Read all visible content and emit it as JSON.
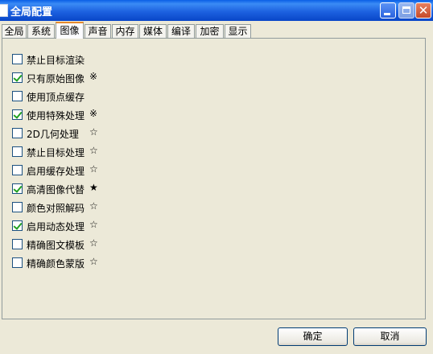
{
  "window": {
    "title": "全局配置"
  },
  "tabs": [
    {
      "label": "全局"
    },
    {
      "label": "系统"
    },
    {
      "label": "图像"
    },
    {
      "label": "声音"
    },
    {
      "label": "内存"
    },
    {
      "label": "媒体"
    },
    {
      "label": "编译"
    },
    {
      "label": "加密"
    },
    {
      "label": "显示"
    }
  ],
  "active_tab": "图像",
  "options": [
    {
      "label": "禁止目标渲染",
      "checked": false,
      "symbol": ""
    },
    {
      "label": "只有原始图像",
      "checked": true,
      "symbol": "※"
    },
    {
      "label": "使用顶点缓存",
      "checked": false,
      "symbol": ""
    },
    {
      "label": "使用特殊处理",
      "checked": true,
      "symbol": "※"
    },
    {
      "label": "2D几何处理",
      "checked": false,
      "symbol": "☆"
    },
    {
      "label": "禁止目标处理",
      "checked": false,
      "symbol": "☆"
    },
    {
      "label": "启用缓存处理",
      "checked": false,
      "symbol": "☆"
    },
    {
      "label": "高清图像代替",
      "checked": true,
      "symbol": "★"
    },
    {
      "label": "颜色对照解码",
      "checked": false,
      "symbol": "☆"
    },
    {
      "label": "启用动态处理",
      "checked": true,
      "symbol": "☆"
    },
    {
      "label": "精确图文模板",
      "checked": false,
      "symbol": "☆"
    },
    {
      "label": "精确颜色蒙版",
      "checked": false,
      "symbol": "☆"
    }
  ],
  "buttons": {
    "ok": "确定",
    "cancel": "取消"
  }
}
